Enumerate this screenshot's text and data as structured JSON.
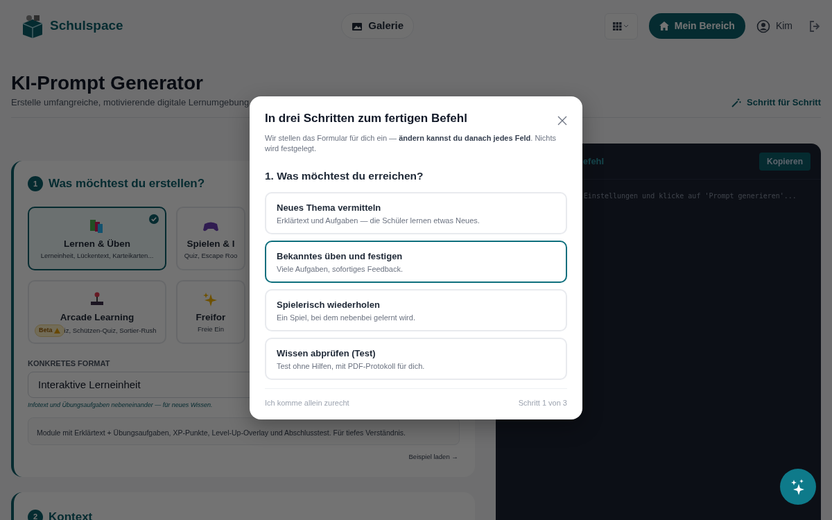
{
  "header": {
    "brand": "Schulspace",
    "gallery": "Galerie",
    "my_area": "Mein Bereich",
    "user": "Kim"
  },
  "page": {
    "title": "KI-Prompt Generator",
    "subtitle": "Erstelle umfangreiche, motivierende digitale Lernumgebung",
    "guide_link": "Schritt für Schritt"
  },
  "section_1": {
    "number": "1",
    "title": "Was möchtest du erstellen?",
    "types": [
      {
        "title": "Lernen & Üben",
        "desc": "Lerneinheit, Lückentext, Karteikarten...",
        "selected": true
      },
      {
        "title": "Spielen & I",
        "desc": "Quiz, Escape Roo",
        "selected": false
      },
      {
        "title": "Arcade Learning",
        "desc": "iz, Schützen-Quiz, Sortier-Rush",
        "badge": "Beta",
        "selected": false
      },
      {
        "title": "Freifor",
        "desc": "Freie Ein",
        "selected": false
      }
    ],
    "format_label": "KONKRETES FORMAT",
    "format_value": "Interaktive Lerneinheit",
    "format_hint": "Infotext und Übungsaufgaben nebeneinander — für neues Wissen.",
    "description": "Module mit Erklärtext + Übungsaufgaben, XP-Punkte, Level-Up-Overlay und Abschlusstest. Für tiefes Verständnis.",
    "example_link": "Beispiel laden →"
  },
  "section_2": {
    "number": "2",
    "title": "Kontext"
  },
  "output": {
    "title": "efehl",
    "copy": "Kopieren",
    "text": "Einstellungen und klicke auf 'Prompt generieren'..."
  },
  "modal": {
    "title": "In drei Schritten zum fertigen Befehl",
    "intro": "Wir stellen das Formular für dich ein — **ändern kannst du danach jedes Feld**. Nichts wird festgelegt.",
    "question": "1. Was möchtest du erreichen?",
    "options": [
      {
        "title": "Neues Thema vermitteln",
        "desc": "Erklärtext und Aufgaben — die Schüler lernen etwas Neues.",
        "selected": false
      },
      {
        "title": "Bekanntes üben und festigen",
        "desc": "Viele Aufgaben, sofortiges Feedback.",
        "selected": true
      },
      {
        "title": "Spielerisch wiederholen",
        "desc": "Ein Spiel, bei dem nebenbei gelernt wird.",
        "selected": false
      },
      {
        "title": "Wissen abprüfen (Test)",
        "desc": "Test ohne Hilfen, mit PDF-Protokoll für dich.",
        "selected": false
      }
    ],
    "skip": "Ich komme allein zurecht",
    "step": "Schritt 1 von 3"
  }
}
